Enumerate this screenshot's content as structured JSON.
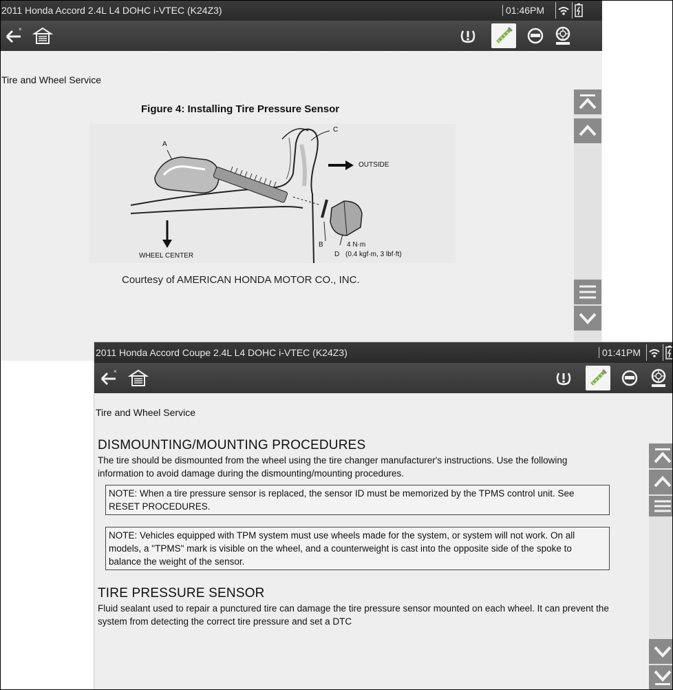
{
  "screen1": {
    "title": "2011 Honda Accord 2.4L L4 DOHC i-VTEC (K24Z3)",
    "time": "01:46PM",
    "section_title": "Tire and Wheel Service",
    "figure": {
      "title": "Figure 4: Installing Tire Pressure Sensor",
      "labels": {
        "a": "A",
        "b": "B",
        "c": "C",
        "d": "D",
        "outside": "OUTSIDE",
        "wheel_center": "WHEEL CENTER",
        "torque": "4 N·m",
        "torque_alt": "(0.4 kgf·m, 3 lbf·ft)"
      },
      "caption": "Courtesy of AMERICAN HONDA MOTOR CO., INC."
    }
  },
  "screen2": {
    "title": "2011 Honda Accord Coupe 2.4L L4 DOHC i-VTEC (K24Z3)",
    "time": "01:41PM",
    "section_title": "Tire and Wheel Service",
    "heading1": "DISMOUNTING/MOUNTING PROCEDURES",
    "para1": "The tire should be dismounted from the wheel using the tire changer manufacturer's instructions. Use the following information to avoid damage during the dismounting/mounting procedures.",
    "note1": "NOTE: When a tire pressure sensor is replaced, the sensor ID must be memorized by the TPMS control unit. See RESET PROCEDURES.",
    "note2": "NOTE: Vehicles equipped with TPM system must use wheels made for the system, or system will not work. On all models, a \"TPMS\" mark is visible on the wheel, and a counterweight is cast into the opposite side of the spoke to balance the weight of the sensor.",
    "heading2": "TIRE PRESSURE SENSOR",
    "para2": "Fluid sealant used to repair a punctured tire can damage the tire pressure sensor mounted on each wheel. It can prevent the system from detecting the correct tire pressure and set a DTC"
  },
  "icons": {
    "back": "back-arrow-icon",
    "home": "home-icon",
    "tpms": "tpms-warning-icon",
    "tool": "tool-icon",
    "sensor": "sensor-icon",
    "tire": "tire-icon",
    "wifi": "wifi-icon",
    "battery": "battery-icon"
  },
  "colors": {
    "title_bar": "#2e2e2e",
    "toolbar": "#3e3e3e",
    "scroll_button": "#8a8a8a",
    "background": "#eeeeee"
  }
}
